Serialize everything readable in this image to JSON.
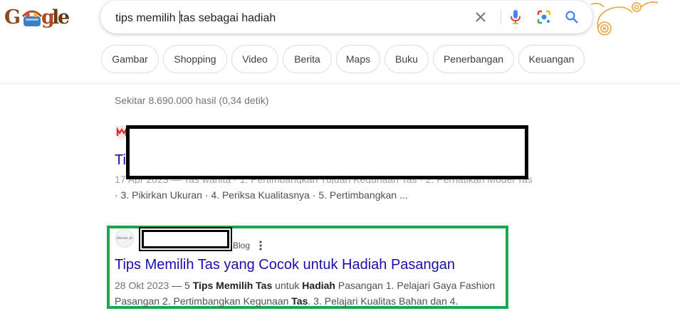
{
  "logo": {
    "letters": [
      "G",
      "o",
      "o",
      "g",
      "l",
      "e"
    ]
  },
  "search": {
    "query_before_caret": "tips memilih ",
    "query_after_caret": "tas sebagai hadiah"
  },
  "chips": [
    "Gambar",
    "Shopping",
    "Video",
    "Berita",
    "Maps",
    "Buku",
    "Penerbangan",
    "Keuangan"
  ],
  "stats": "Sekitar 8.690.000 hasil (0,34 detik)",
  "result1": {
    "title_partial": "Ti",
    "snippet_line1_partial": "17 Apr 2023 — Tas wanita · 1. Pertimbangkan Tujuan Kegunaan Tas · 2. Perhatikan Model Tas",
    "snippet_line2": "· 3. Pikirkan Ukuran · 4. Periksa Kualitasnya · 5. Pertimbangkan ..."
  },
  "result2": {
    "favicon_text": "Monin fo",
    "tag": "Blog",
    "title": "Tips Memilih Tas yang Cocok untuk Hadiah Pasangan",
    "date": "28 Okt 2023",
    "sep": " — 5 ",
    "b1": "Tips Memilih Tas",
    "t1": " untuk ",
    "b2": "Hadiah",
    "t2": " Pasangan 1. Pelajari Gaya Fashion Pasangan 2. Pertimbangkan Kegunaan ",
    "b3": "Tas",
    "t3": ". 3. Pelajari Kualitas Bahan dan 4."
  },
  "colors": {
    "link": "#1a0dab",
    "highlight_border": "#1fa54c",
    "deco": "#e8a53a"
  }
}
